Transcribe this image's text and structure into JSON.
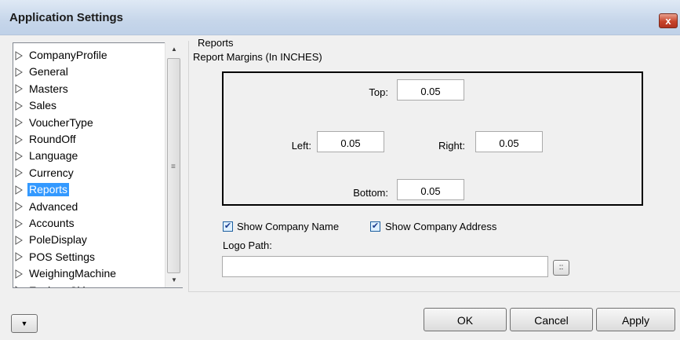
{
  "window": {
    "title": "Application Settings",
    "close_label": "x"
  },
  "tree": {
    "items": [
      {
        "label": "CompanyProfile",
        "selected": false
      },
      {
        "label": "General",
        "selected": false
      },
      {
        "label": "Masters",
        "selected": false
      },
      {
        "label": "Sales",
        "selected": false
      },
      {
        "label": "VoucherType",
        "selected": false
      },
      {
        "label": "RoundOff",
        "selected": false
      },
      {
        "label": "Language",
        "selected": false
      },
      {
        "label": "Currency",
        "selected": false
      },
      {
        "label": "Reports",
        "selected": true
      },
      {
        "label": "Advanced",
        "selected": false
      },
      {
        "label": "Accounts",
        "selected": false
      },
      {
        "label": "PoleDisplay",
        "selected": false
      },
      {
        "label": "POS Settings",
        "selected": false
      },
      {
        "label": "WeighingMachine",
        "selected": false
      },
      {
        "label": "ExplorerSkin",
        "selected": false
      }
    ]
  },
  "reports": {
    "section_title": "Reports",
    "margins_title": "Report Margins (In INCHES)",
    "top": {
      "label": "Top:",
      "value": "0.05"
    },
    "left": {
      "label": "Left:",
      "value": "0.05"
    },
    "right": {
      "label": "Right:",
      "value": "0.05"
    },
    "bottom": {
      "label": "Bottom:",
      "value": "0.05"
    },
    "show_company_name": {
      "label": "Show Company Name",
      "checked": true
    },
    "show_company_address": {
      "label": "Show Company Address",
      "checked": true
    },
    "logo_path": {
      "label": "Logo Path:",
      "value": ""
    },
    "browse_label": "::"
  },
  "footer": {
    "ok": "OK",
    "cancel": "Cancel",
    "apply": "Apply"
  },
  "colors": {
    "selection": "#3399ff",
    "titlebar": "#c6d6ea",
    "close": "#c7442b"
  }
}
